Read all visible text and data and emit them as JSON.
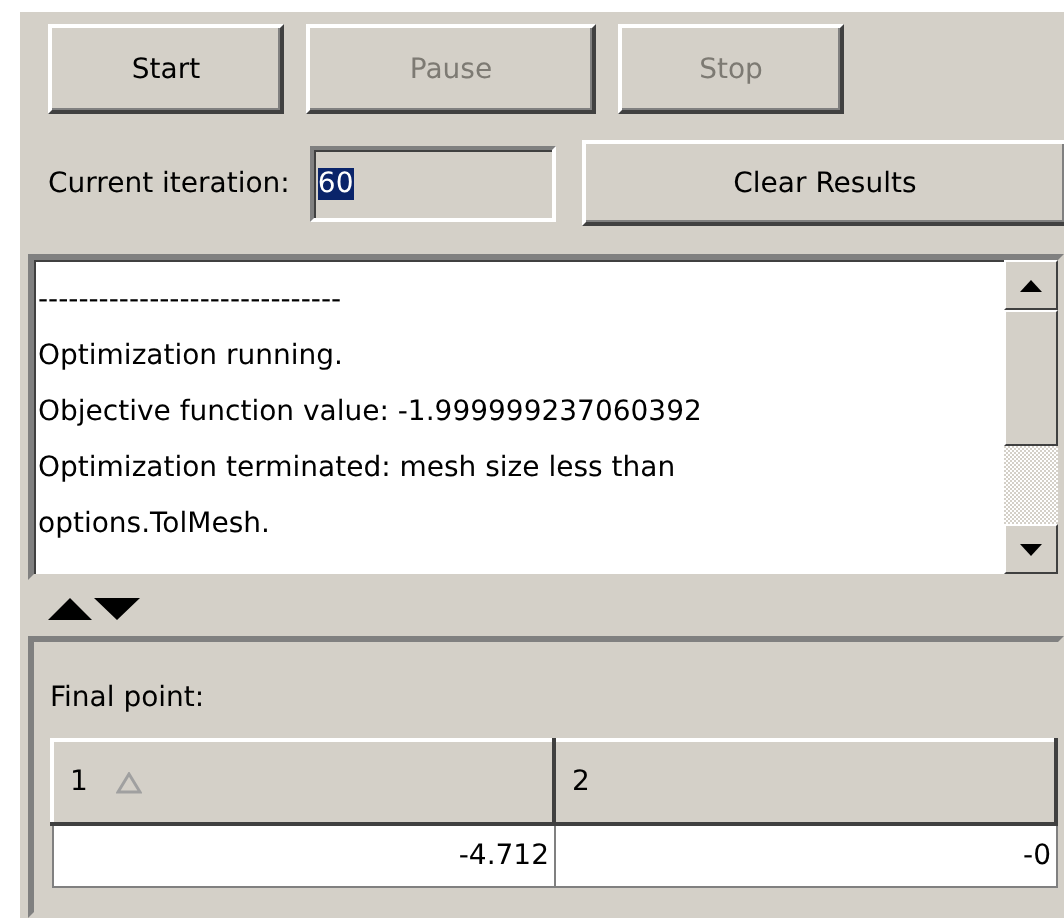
{
  "buttons": [
    {
      "label": "Start",
      "disabled": false
    },
    {
      "label": "Pause",
      "disabled": true
    },
    {
      "label": "Stop",
      "disabled": true
    }
  ],
  "iteration": {
    "label": "Current iteration:",
    "value": "60",
    "text_selected": true
  },
  "clear_button": {
    "label": "Clear Results",
    "disabled": false
  },
  "log": {
    "lines": [
      "------------------------------",
      "Optimization running.",
      "Objective function value: -1.999999237060392",
      "Optimization terminated: mesh size less than",
      "options.TolMesh."
    ]
  },
  "final_point": {
    "label": "Final point:",
    "table": {
      "columns": [
        {
          "label": "1",
          "sorted": true
        },
        {
          "label": "2",
          "sorted": false
        }
      ],
      "rows": [
        [
          "-4.712",
          "-0"
        ]
      ]
    }
  }
}
